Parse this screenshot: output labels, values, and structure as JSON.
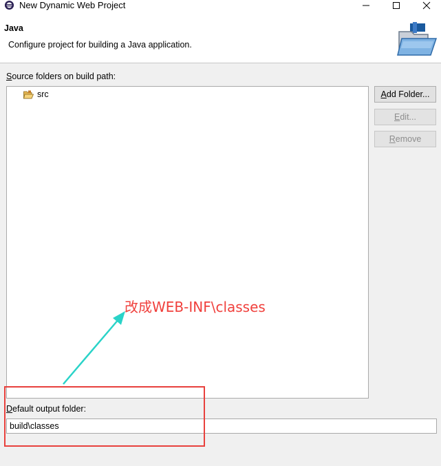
{
  "window": {
    "title": "New Dynamic Web Project",
    "controls": [
      "minimize",
      "maximize",
      "close"
    ]
  },
  "header": {
    "title": "Java",
    "description": "Configure project for building a Java application.",
    "graphic": "java-project-folder-icon"
  },
  "source": {
    "label_first": "S",
    "label_rest": "ource folders on build path:",
    "items": [
      {
        "label": "src",
        "icon": "package-folder-icon"
      }
    ]
  },
  "buttons": {
    "add_first": "A",
    "add_rest": "dd Folder...",
    "edit_first": "E",
    "edit_rest": "dit...",
    "remove_first": "R",
    "remove_rest": "emove"
  },
  "output": {
    "label_first": "D",
    "label_rest": "efault output folder:",
    "value": "build\\classes"
  },
  "annotation": {
    "text": "改成WEB-INF\\classes",
    "color": "#f0403c",
    "arrow_color": "#2ad3c8",
    "box_color": "#e8403c"
  }
}
